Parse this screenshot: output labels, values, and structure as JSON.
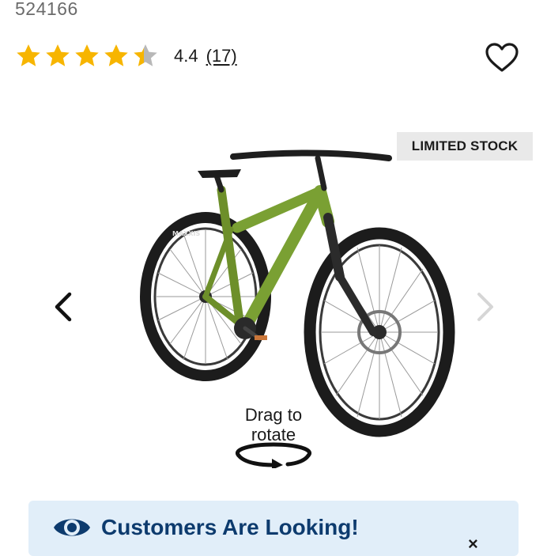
{
  "product": {
    "sku": "524166"
  },
  "rating": {
    "value": "4.4",
    "count_label": "(17)",
    "stars_total": 5,
    "stars_fraction": 0.44,
    "star_color": "#f7b500",
    "star_empty_color": "#b8b8b8"
  },
  "badge": {
    "label": "LIMITED STOCK"
  },
  "viewer": {
    "hint": "Drag to\nrotate",
    "image_subject": "green hardtail mountain bike",
    "prev_icon": "chevron-left-icon",
    "next_icon": "chevron-right-icon",
    "tire_brand": "MAXXIS"
  },
  "banner": {
    "title": "Customers Are Looking!",
    "close_label": "×",
    "icon": "eye-icon",
    "background": "#e1eef9",
    "title_color": "#0d3b6e"
  }
}
